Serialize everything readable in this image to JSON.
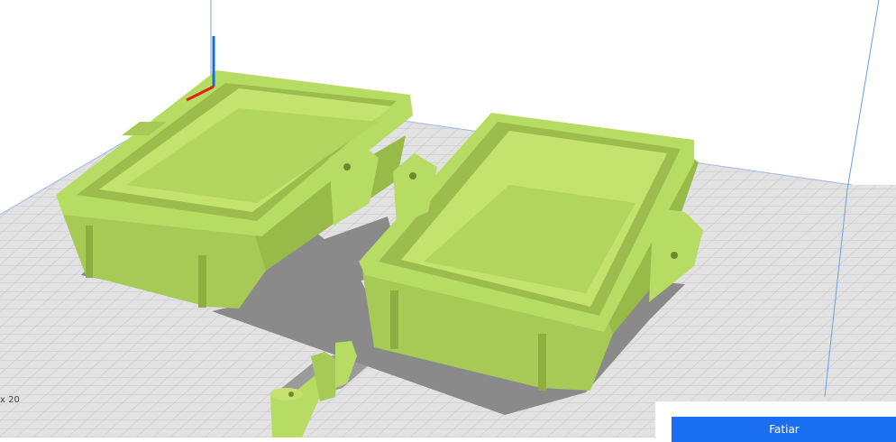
{
  "viewport": {
    "build_plate_color": "#e2e2e2",
    "grid_color": "#c2c2c2",
    "shadow_color": "#8a8a8a",
    "model_color": "#b7dc63",
    "model_dark_color": "#9cbd4e",
    "axis_x_color": "#e0201c",
    "axis_y_color": "#1f6bd6",
    "dimension_readout": "x 20"
  },
  "slice_panel": {
    "button_label": "Fatiar",
    "button_color": "#1a6ff0"
  }
}
